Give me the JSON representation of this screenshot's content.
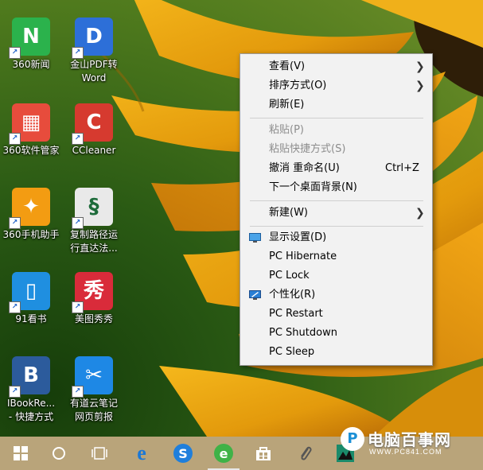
{
  "desktop": {
    "icons": [
      {
        "label_lines": [
          "360新闻"
        ],
        "icon": "360-news-icon",
        "color": "#2bb24c"
      },
      {
        "label_lines": [
          "金山PDF转",
          "Word"
        ],
        "icon": "kingsoft-pdf-icon",
        "color": "#2d6fd8"
      },
      {
        "label_lines": [
          "360软件管家"
        ],
        "icon": "360-software-manager-icon",
        "color": "#e74c3c"
      },
      {
        "label_lines": [
          "CCleaner"
        ],
        "icon": "ccleaner-icon",
        "color": "#d63a2f"
      },
      {
        "label_lines": [
          "360手机助手"
        ],
        "icon": "360-phone-assistant-icon",
        "color": "#f39c12"
      },
      {
        "label_lines": [
          "复制路径运",
          "行直达法..."
        ],
        "icon": "script-file-icon",
        "color": "#e9e9e9"
      },
      {
        "label_lines": [
          "91看书"
        ],
        "icon": "91-reader-icon",
        "color": "#1f8fe0"
      },
      {
        "label_lines": [
          "美图秀秀"
        ],
        "icon": "meitu-icon",
        "color": "#d92b3a"
      },
      {
        "label_lines": [
          "IBookRe...",
          "- 快捷方式"
        ],
        "icon": "ibook-reader-icon",
        "color": "#2c5b9c"
      },
      {
        "label_lines": [
          "有道云笔记",
          "网页剪报"
        ],
        "icon": "youdao-clipper-icon",
        "color": "#1e88e5"
      }
    ]
  },
  "context_menu": {
    "items": [
      {
        "label": "查看(V)",
        "submenu": true
      },
      {
        "label": "排序方式(O)",
        "submenu": true
      },
      {
        "label": "刷新(E)"
      },
      {
        "label": "粘贴(P)",
        "disabled": true
      },
      {
        "label": "粘贴快捷方式(S)",
        "disabled": true
      },
      {
        "label": "撤消 重命名(U)",
        "shortcut": "Ctrl+Z"
      },
      {
        "label": "下一个桌面背景(N)"
      },
      {
        "label": "新建(W)",
        "submenu": true
      },
      {
        "label": "显示设置(D)",
        "icon": "display-settings-icon"
      },
      {
        "label": "PC Hibernate"
      },
      {
        "label": "PC Lock"
      },
      {
        "label": "个性化(R)",
        "icon": "personalize-icon"
      },
      {
        "label": "PC Restart"
      },
      {
        "label": "PC Shutdown"
      },
      {
        "label": "PC Sleep"
      }
    ]
  },
  "taskbar": {
    "buttons": [
      "start-windows-icon",
      "search-circle-icon",
      "task-view-icon",
      "edge-browser-icon",
      "sogou-browser-icon",
      "360-browser-icon",
      "store-icon",
      "paperclip-icon",
      "app-icon"
    ],
    "active_index": 5
  },
  "watermark": {
    "logo": "P",
    "name": "电脑百事网",
    "url": "WWW.PC841.COM"
  },
  "colors": {
    "menu_bg": "#f2f2f2",
    "disabled_text": "#8d8d8d",
    "taskbar": "#b9a47a"
  }
}
